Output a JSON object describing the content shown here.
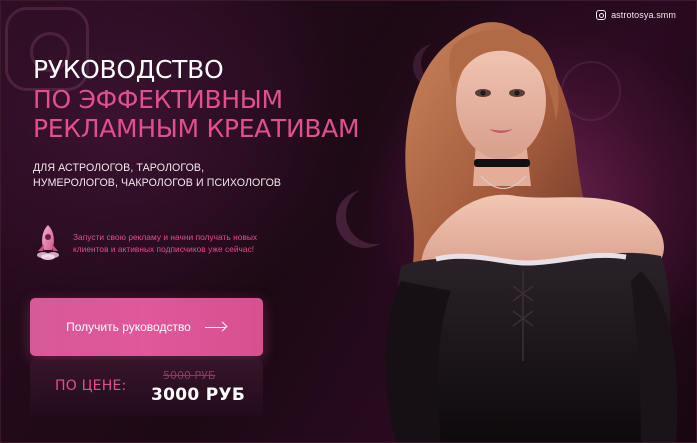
{
  "handle": {
    "text": "astrotosya.smm",
    "icon": "instagram-icon"
  },
  "headline": {
    "line1": "РУКОВОДСТВО",
    "line2": "ПО ЭФФЕКТИВНЫМ",
    "line3": "РЕКЛАМНЫМ КРЕАТИВАМ"
  },
  "subtitle": {
    "line1": "ДЛЯ АСТРОЛОГОВ, ТАРОЛОГОВ,",
    "line2": "НУМЕРОЛОГОВ, ЧАКРОЛОГОВ И ПСИХОЛОГОВ"
  },
  "promo": {
    "icon": "rocket-icon",
    "line1": "Запусти свою рекламу и начни получать новых",
    "line2": "клиентов и активных подписчиков уже сейчас!"
  },
  "cta": {
    "label": "Получить руководство",
    "icon": "arrow-right-icon"
  },
  "price": {
    "label": "ПО ЦЕНЕ:",
    "old": "5000 РУБ",
    "new": "3000 РУБ"
  },
  "colors": {
    "accent": "#e0508f",
    "background": "#1c0914",
    "button": "#dd5697",
    "text": "#ffffff"
  }
}
